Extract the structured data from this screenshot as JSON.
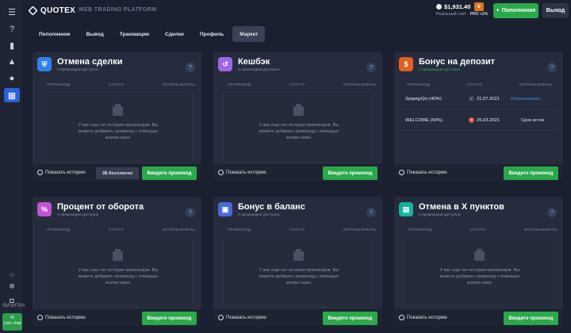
{
  "header": {
    "logo": "QUOTEX",
    "platform": "WEB TRADING PLATFORM",
    "balance": "$1,931.40",
    "account_type": "Реальный счет",
    "pro_label": "PRO +2%",
    "deposit_label": "Пополнение",
    "logout_label": "Выход"
  },
  "sidebar": {
    "bottom_label": "ВИЗИТКА",
    "live_chat": "Live chat"
  },
  "tabs": [
    {
      "label": "Пополнение"
    },
    {
      "label": "Вывод"
    },
    {
      "label": "Транзакции"
    },
    {
      "label": "Сделки"
    },
    {
      "label": "Профиль"
    },
    {
      "label": "Маркет"
    }
  ],
  "columns": {
    "promocode": "ПРОМОКОД",
    "status": "СТАТУС",
    "use": "ИСПОЛЬЗОВАТЬ"
  },
  "empty_text": "У вас еще нет истории промокодов. Вы можете добавить промокод с помощью кнопки ниже.",
  "history_label": "Показать историю",
  "enter_label": "Введите промокод",
  "cards": [
    {
      "title": "Отмена сделки",
      "sub": "0 промокодов доступно",
      "icon": "shield-icon",
      "color": "#2f80ed",
      "free_label": "3$ бесплатно"
    },
    {
      "title": "Кешбэк",
      "sub": "0 промокодов доступно",
      "icon": "cashback-icon",
      "color": "#a065e8"
    },
    {
      "title": "Бонус на депозит",
      "sub": "1 промокодов доступно",
      "icon": "money-bag-icon",
      "color": "#e0611f"
    },
    {
      "title": "Процент от оборота",
      "sub": "0 промокодов доступно",
      "icon": "percent-icon",
      "color": "#c252d4"
    },
    {
      "title": "Бонус в баланс",
      "sub": "0 промокодов доступно",
      "icon": "gift-icon",
      "color": "#4a6ad8"
    },
    {
      "title": "Отмена в X пунктов",
      "sub": "0 промокодов доступно",
      "icon": "calendar-icon",
      "color": "#13b3a0"
    }
  ],
  "deposit_promos": [
    {
      "code": "2pqwqyQci (40%)",
      "date": "31.07.2021",
      "action": "Использовать",
      "status": "ok"
    },
    {
      "code": "WELCOME (40%)",
      "date": "25.03.2021",
      "action": "Срок истек",
      "status": "expired"
    }
  ]
}
